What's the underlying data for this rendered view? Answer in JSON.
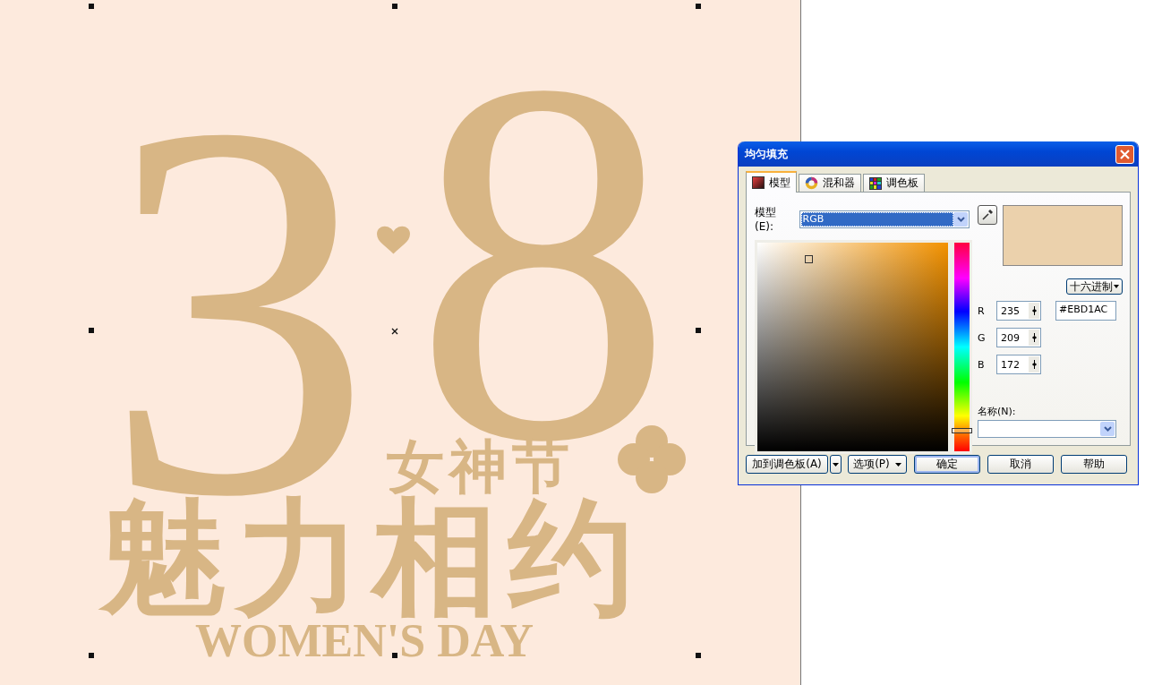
{
  "canvas": {
    "artwork": {
      "digits": [
        "3",
        "8"
      ],
      "title": "女神节",
      "slogan": "魅力相约",
      "subtitle": "WOMEN'S DAY"
    }
  },
  "dialog": {
    "title": "均匀填充",
    "tabs": [
      {
        "label": "模型",
        "selected": true,
        "kind": "model"
      },
      {
        "label": "混和器",
        "selected": false,
        "kind": "mixer"
      },
      {
        "label": "调色板",
        "selected": false,
        "kind": "palette"
      }
    ],
    "model_label": "模型(E):",
    "model_value": "RGB",
    "hue_slider": {
      "level": 0.1
    },
    "format_button": "十六进制",
    "channels": [
      {
        "label": "R",
        "value": "235"
      },
      {
        "label": "G",
        "value": "209"
      },
      {
        "label": "B",
        "value": "172"
      }
    ],
    "hex_value": "#EBD1AC",
    "name_label": "名称(N):",
    "buttons": [
      {
        "label": "加到调色板(A)",
        "kind": "split"
      },
      {
        "label": "选项(P)",
        "kind": "menu"
      },
      {
        "label": "确定",
        "kind": "default"
      },
      {
        "label": "取消",
        "kind": "plain"
      },
      {
        "label": "帮助",
        "kind": "plain"
      }
    ]
  }
}
